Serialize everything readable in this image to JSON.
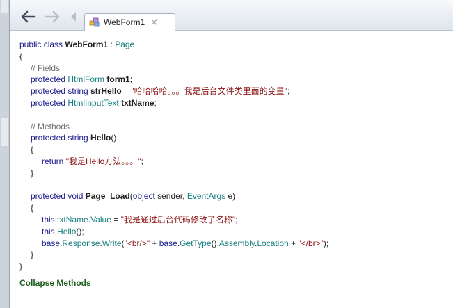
{
  "tab": {
    "label": "WebForm1",
    "close": "×"
  },
  "code_lines": [
    {
      "indent": 0,
      "tokens": [
        {
          "t": "public class ",
          "c": "kw"
        },
        {
          "t": "WebForm1",
          "c": "b"
        },
        {
          "t": " : ",
          "c": ""
        },
        {
          "t": "Page",
          "c": "ty"
        }
      ]
    },
    {
      "indent": 0,
      "tokens": [
        {
          "t": "{",
          "c": ""
        }
      ]
    },
    {
      "indent": 1,
      "tokens": [
        {
          "t": "// Fields",
          "c": "cm"
        }
      ]
    },
    {
      "indent": 1,
      "tokens": [
        {
          "t": "protected ",
          "c": "kw"
        },
        {
          "t": "HtmlForm",
          "c": "ty"
        },
        {
          "t": " ",
          "c": ""
        },
        {
          "t": "form1",
          "c": "b"
        },
        {
          "t": ";",
          "c": ""
        }
      ]
    },
    {
      "indent": 1,
      "tokens": [
        {
          "t": "protected string ",
          "c": "kw"
        },
        {
          "t": "strHello",
          "c": "b"
        },
        {
          "t": " = ",
          "c": ""
        },
        {
          "t": "\"哈哈哈哈。。。我是后台文件类里面的变量\"",
          "c": "st"
        },
        {
          "t": ";",
          "c": ""
        }
      ]
    },
    {
      "indent": 1,
      "tokens": [
        {
          "t": "protected ",
          "c": "kw"
        },
        {
          "t": "HtmlInputText",
          "c": "ty"
        },
        {
          "t": " ",
          "c": ""
        },
        {
          "t": "txtName",
          "c": "b"
        },
        {
          "t": ";",
          "c": ""
        }
      ]
    },
    {
      "indent": 0,
      "tokens": [
        {
          "t": "",
          "c": ""
        }
      ]
    },
    {
      "indent": 1,
      "tokens": [
        {
          "t": "// Methods",
          "c": "cm"
        }
      ]
    },
    {
      "indent": 1,
      "tokens": [
        {
          "t": "protected string ",
          "c": "kw"
        },
        {
          "t": "Hello",
          "c": "b"
        },
        {
          "t": "()",
          "c": ""
        }
      ]
    },
    {
      "indent": 1,
      "tokens": [
        {
          "t": "{",
          "c": ""
        }
      ]
    },
    {
      "indent": 2,
      "tokens": [
        {
          "t": "return ",
          "c": "kw"
        },
        {
          "t": "\"我是Hello方法。。。\"",
          "c": "st"
        },
        {
          "t": ";",
          "c": ""
        }
      ]
    },
    {
      "indent": 1,
      "tokens": [
        {
          "t": "}",
          "c": ""
        }
      ]
    },
    {
      "indent": 0,
      "tokens": [
        {
          "t": "",
          "c": ""
        }
      ]
    },
    {
      "indent": 1,
      "tokens": [
        {
          "t": "protected void ",
          "c": "kw"
        },
        {
          "t": "Page_Load",
          "c": "b"
        },
        {
          "t": "(",
          "c": ""
        },
        {
          "t": "object",
          "c": "kw"
        },
        {
          "t": " sender, ",
          "c": ""
        },
        {
          "t": "EventArgs",
          "c": "ty"
        },
        {
          "t": " e)",
          "c": ""
        }
      ]
    },
    {
      "indent": 1,
      "tokens": [
        {
          "t": "{",
          "c": ""
        }
      ]
    },
    {
      "indent": 2,
      "tokens": [
        {
          "t": "this",
          "c": "kw"
        },
        {
          "t": ".",
          "c": ""
        },
        {
          "t": "txtName",
          "c": "ty"
        },
        {
          "t": ".",
          "c": ""
        },
        {
          "t": "Value",
          "c": "ty"
        },
        {
          "t": " = ",
          "c": ""
        },
        {
          "t": "\"我是通过后台代码修改了名称\"",
          "c": "st"
        },
        {
          "t": ";",
          "c": ""
        }
      ]
    },
    {
      "indent": 2,
      "tokens": [
        {
          "t": "this",
          "c": "kw"
        },
        {
          "t": ".",
          "c": ""
        },
        {
          "t": "Hello",
          "c": "ty"
        },
        {
          "t": "();",
          "c": ""
        }
      ]
    },
    {
      "indent": 2,
      "tokens": [
        {
          "t": "base",
          "c": "kw"
        },
        {
          "t": ".",
          "c": ""
        },
        {
          "t": "Response",
          "c": "ty"
        },
        {
          "t": ".",
          "c": ""
        },
        {
          "t": "Write",
          "c": "ty"
        },
        {
          "t": "(",
          "c": ""
        },
        {
          "t": "\"<br/>\"",
          "c": "st"
        },
        {
          "t": " + ",
          "c": ""
        },
        {
          "t": "base",
          "c": "kw"
        },
        {
          "t": ".",
          "c": ""
        },
        {
          "t": "GetType",
          "c": "ty"
        },
        {
          "t": "().",
          "c": ""
        },
        {
          "t": "Assembly",
          "c": "ty"
        },
        {
          "t": ".",
          "c": ""
        },
        {
          "t": "Location",
          "c": "ty"
        },
        {
          "t": " + ",
          "c": ""
        },
        {
          "t": "\"</br>\"",
          "c": "st"
        },
        {
          "t": ");",
          "c": ""
        }
      ]
    },
    {
      "indent": 1,
      "tokens": [
        {
          "t": "}",
          "c": ""
        }
      ]
    },
    {
      "indent": 0,
      "tokens": [
        {
          "t": "}",
          "c": ""
        }
      ]
    }
  ],
  "collapse_label": "Collapse Methods",
  "icons": {
    "back": "back-arrow-icon",
    "forward": "forward-arrow-icon",
    "tab": "class-icon"
  },
  "colors": {
    "keyword": "#1a1a8c",
    "type": "#157e80",
    "comment": "#717171",
    "string": "#8b1414",
    "collapse": "#1c5e1c"
  }
}
